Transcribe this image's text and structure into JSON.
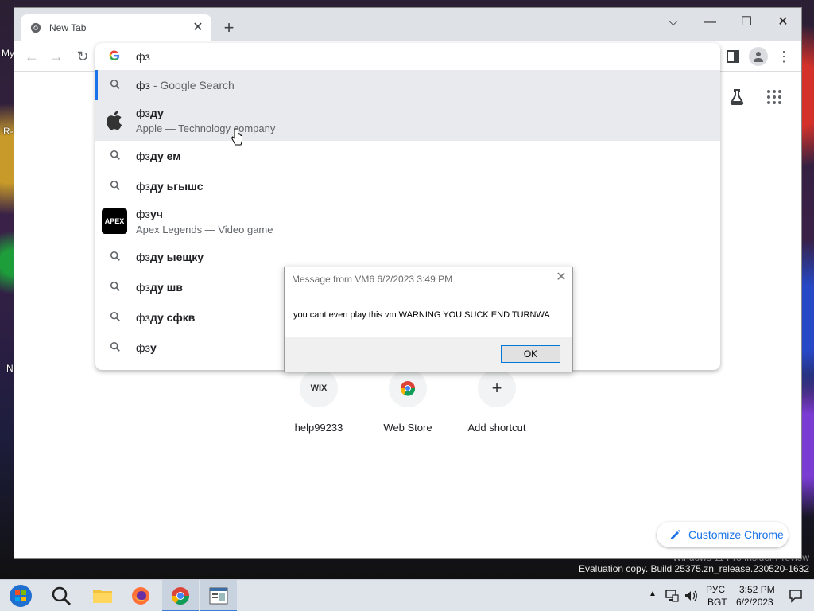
{
  "desktop": {
    "fragments": [
      "My",
      "R-",
      "N"
    ],
    "watermark_line1": "Windows 11 Pro Insider Preview",
    "watermark_line2": "Evaluation copy. Build 25375.zn_release.230520-1632"
  },
  "browser": {
    "tab": {
      "title": "New Tab",
      "close": "✕"
    },
    "new_tab": "+",
    "window_controls": {
      "tab_search": "⌵",
      "minimize": "—",
      "maximize": "☐",
      "close": "✕"
    },
    "nav": {
      "back": "←",
      "forward": "→",
      "reload": "↻"
    },
    "menu": "⋮"
  },
  "omnibox": {
    "input_value": "фз",
    "suggestions": [
      {
        "type": "search",
        "typed": "фз",
        "rest": " - Google Search",
        "selected": true
      },
      {
        "type": "entity",
        "typed": "фз",
        "rest": "ду",
        "desc": "Apple — Technology company",
        "thumb": "apple-logo-icon"
      },
      {
        "type": "search",
        "typed": "фз",
        "rest": "ду ем"
      },
      {
        "type": "search",
        "typed": "фз",
        "rest": "ду ьгышс"
      },
      {
        "type": "entity",
        "typed": "фз",
        "rest": "уч",
        "desc": "Apex Legends — Video game",
        "thumb": "apex-logo-icon",
        "thumb_text": "APEX"
      },
      {
        "type": "search",
        "typed": "фз",
        "rest": "ду ыещку"
      },
      {
        "type": "search",
        "typed": "фз",
        "rest": "ду шв"
      },
      {
        "type": "search",
        "typed": "фз",
        "rest": "ду сфкв"
      },
      {
        "type": "search",
        "typed": "фз",
        "rest": "у"
      }
    ]
  },
  "ntp": {
    "shortcuts": [
      {
        "label": "help99233",
        "icon_text": "WIX"
      },
      {
        "label": "Web Store",
        "icon_text": ""
      },
      {
        "label": "Add shortcut",
        "icon_text": "+"
      }
    ],
    "customize_label": "Customize Chrome"
  },
  "dialog": {
    "title": "Message from VM6 6/2/2023 3:49 PM",
    "message": "you cant even play this vm WARNING YOU SUCK END TURNWA",
    "ok_label": "OK",
    "close": "✕"
  },
  "taskbar": {
    "language_line1": "РУС",
    "language_line2": "BGT",
    "time": "3:52 PM",
    "date": "6/2/2023"
  },
  "colors": {
    "accent": "#1a73e8",
    "tab_strip": "#dee1e6",
    "taskbar": "#dfe3ea"
  }
}
